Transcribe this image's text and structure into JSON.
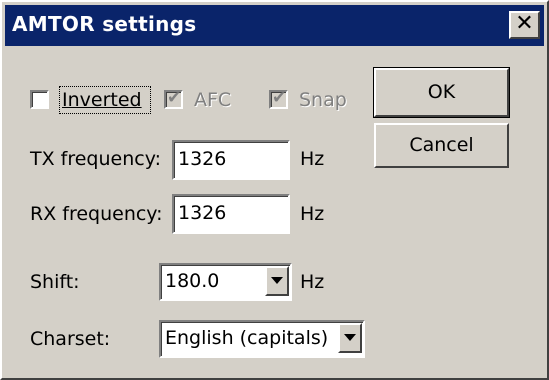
{
  "window": {
    "title": "AMTOR settings",
    "close_glyph": "✕"
  },
  "checkboxes": {
    "inverted": {
      "label": "Inverted",
      "checked": false,
      "enabled": true
    },
    "afc": {
      "label": "AFC",
      "checked": true,
      "enabled": false
    },
    "snap": {
      "label": "Snap",
      "checked": true,
      "enabled": false
    }
  },
  "buttons": {
    "ok": "OK",
    "cancel": "Cancel"
  },
  "fields": {
    "tx_frequency": {
      "label": "TX frequency:",
      "value": "1326",
      "unit": "Hz"
    },
    "rx_frequency": {
      "label": "RX frequency:",
      "value": "1326",
      "unit": "Hz"
    },
    "shift": {
      "label": "Shift:",
      "value": "180.0",
      "unit": "Hz"
    },
    "charset": {
      "label": "Charset:",
      "value": "English (capitals)"
    }
  },
  "colors": {
    "titlebar": "#0a246a",
    "face": "#d4d0c8"
  }
}
